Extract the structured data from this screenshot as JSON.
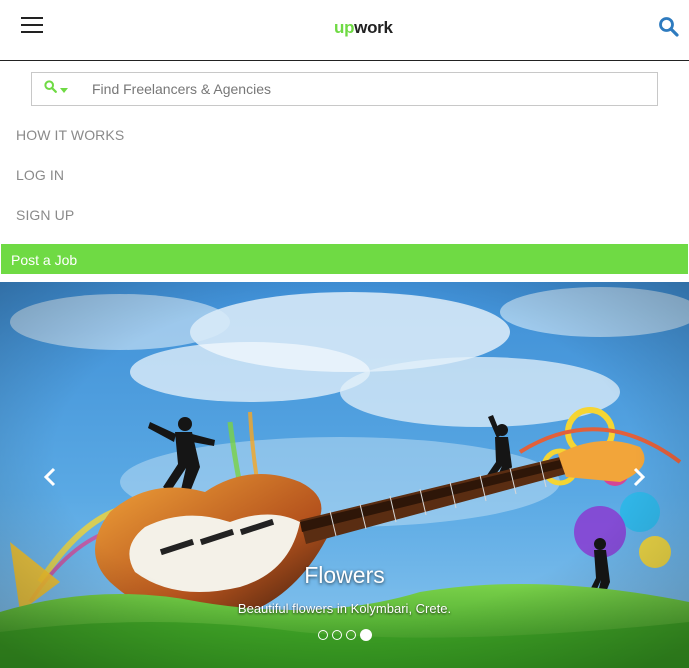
{
  "header": {
    "logo_up": "up",
    "logo_work": "work",
    "brand_color": "#6fda44",
    "menu_icon": "hamburger-icon",
    "search_icon": "search-icon"
  },
  "search": {
    "placeholder": "Find Freelancers & Agencies",
    "value": "",
    "type_icon": "search-icon"
  },
  "nav": {
    "items": [
      {
        "label": "HOW IT WORKS"
      },
      {
        "label": "LOG IN"
      },
      {
        "label": "SIGN UP"
      }
    ]
  },
  "cta": {
    "post_job_label": "Post a Job",
    "color": "#6fda44"
  },
  "carousel": {
    "caption_title": "Flowers",
    "caption_text": "Beautiful flowers in Kolymbari, Crete.",
    "prev_icon": "chevron-left-icon",
    "next_icon": "chevron-right-icon",
    "slide_count": 4,
    "active_index": 3
  }
}
